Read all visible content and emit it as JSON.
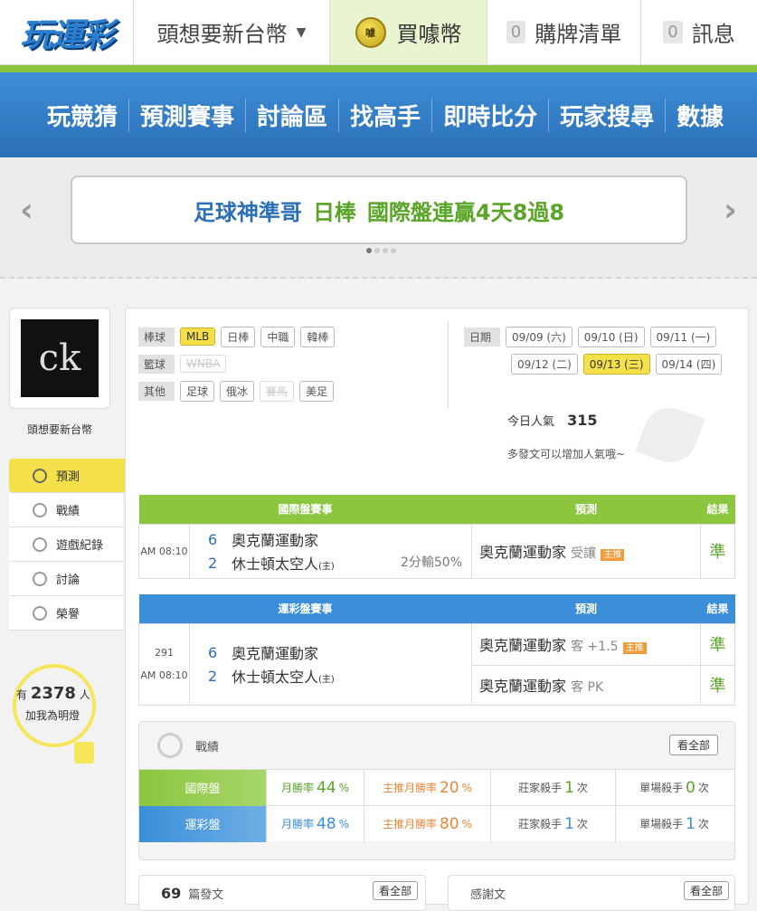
{
  "header": {
    "logo": "玩運彩",
    "username": "頭想要新台幣",
    "buy_coin": "買噱幣",
    "coin_label": "噱",
    "cart_count": "0",
    "cart_label": "購牌清單",
    "msg_count": "0",
    "msg_label": "訊息"
  },
  "nav": [
    "玩競猜",
    "預測賽事",
    "討論區",
    "找高手",
    "即時比分",
    "玩家搜尋",
    "數據"
  ],
  "banner": {
    "part1": "足球神準哥",
    "part2": "日棒",
    "part3": "國際盤連贏4天8過8"
  },
  "sidebar": {
    "name": "頭想要新台幣",
    "items": [
      "預測",
      "戰績",
      "遊戲紀錄",
      "討論",
      "榮譽"
    ],
    "fans_prefix": "有",
    "fans_count": "2378",
    "fans_suffix": "人",
    "fans_cta": "加我為明燈"
  },
  "filters": {
    "baseball_label": "棒球",
    "baseball": [
      "MLB",
      "日棒",
      "中職",
      "韓棒"
    ],
    "basketball_label": "籃球",
    "basketball": [
      "WNBA"
    ],
    "other_label": "其他",
    "other": [
      "足球",
      "俄冰",
      "賽馬",
      "美足"
    ],
    "date_label": "日期",
    "dates_row1": [
      "09/09 (六)",
      "09/10 (日)",
      "09/11 (一)"
    ],
    "dates_row2": [
      "09/12 (二)",
      "09/13 (三)",
      "09/14 (四)"
    ]
  },
  "popularity": {
    "label": "今日人氣",
    "value": "315",
    "tip": "多發文可以增加人氣哦~"
  },
  "intl_table": {
    "h_match": "國際盤賽事",
    "h_pred": "預測",
    "h_result": "結果",
    "time": "AM 08:10",
    "score1": "6",
    "team1": "奧克蘭運動家",
    "score2": "2",
    "team2": "休士頓太空人",
    "host": "(主)",
    "handicap": "2分輸50%",
    "pred_team": "奧克蘭運動家",
    "pred_type": "受讓",
    "tag": "主推",
    "result": "準"
  },
  "lottery_table": {
    "h_match": "運彩盤賽事",
    "h_pred": "預測",
    "h_result": "結果",
    "game_no": "291",
    "time": "AM 08:10",
    "score1": "6",
    "team1": "奧克蘭運動家",
    "score2": "2",
    "team2": "休士頓太空人",
    "host": "(主)",
    "pred1_team": "奧克蘭運動家",
    "pred1_type": "客 +1.5",
    "tag": "主推",
    "result1": "準",
    "pred2_team": "奧克蘭運動家",
    "pred2_type": "客 PK",
    "result2": "準"
  },
  "record": {
    "title": "戰績",
    "see_all": "看全部",
    "rows": [
      {
        "label": "國際盤",
        "month_label": "月勝率",
        "month": "44",
        "main_label": "主推月勝率",
        "main": "20",
        "pct": "%",
        "banker_label": "莊家殺手",
        "banker": "1",
        "single_label": "單場殺手",
        "single": "0",
        "times": "次"
      },
      {
        "label": "運彩盤",
        "month_label": "月勝率",
        "month": "48",
        "main_label": "主推月勝率",
        "main": "80",
        "pct": "%",
        "banker_label": "莊家殺手",
        "banker": "1",
        "single_label": "單場殺手",
        "single": "1",
        "times": "次"
      }
    ]
  },
  "bottom": {
    "posts_count": "69",
    "posts_label": "篇發文",
    "posts_see": "看全部",
    "thanks_label": "感謝文",
    "thanks_see": "看全部"
  }
}
